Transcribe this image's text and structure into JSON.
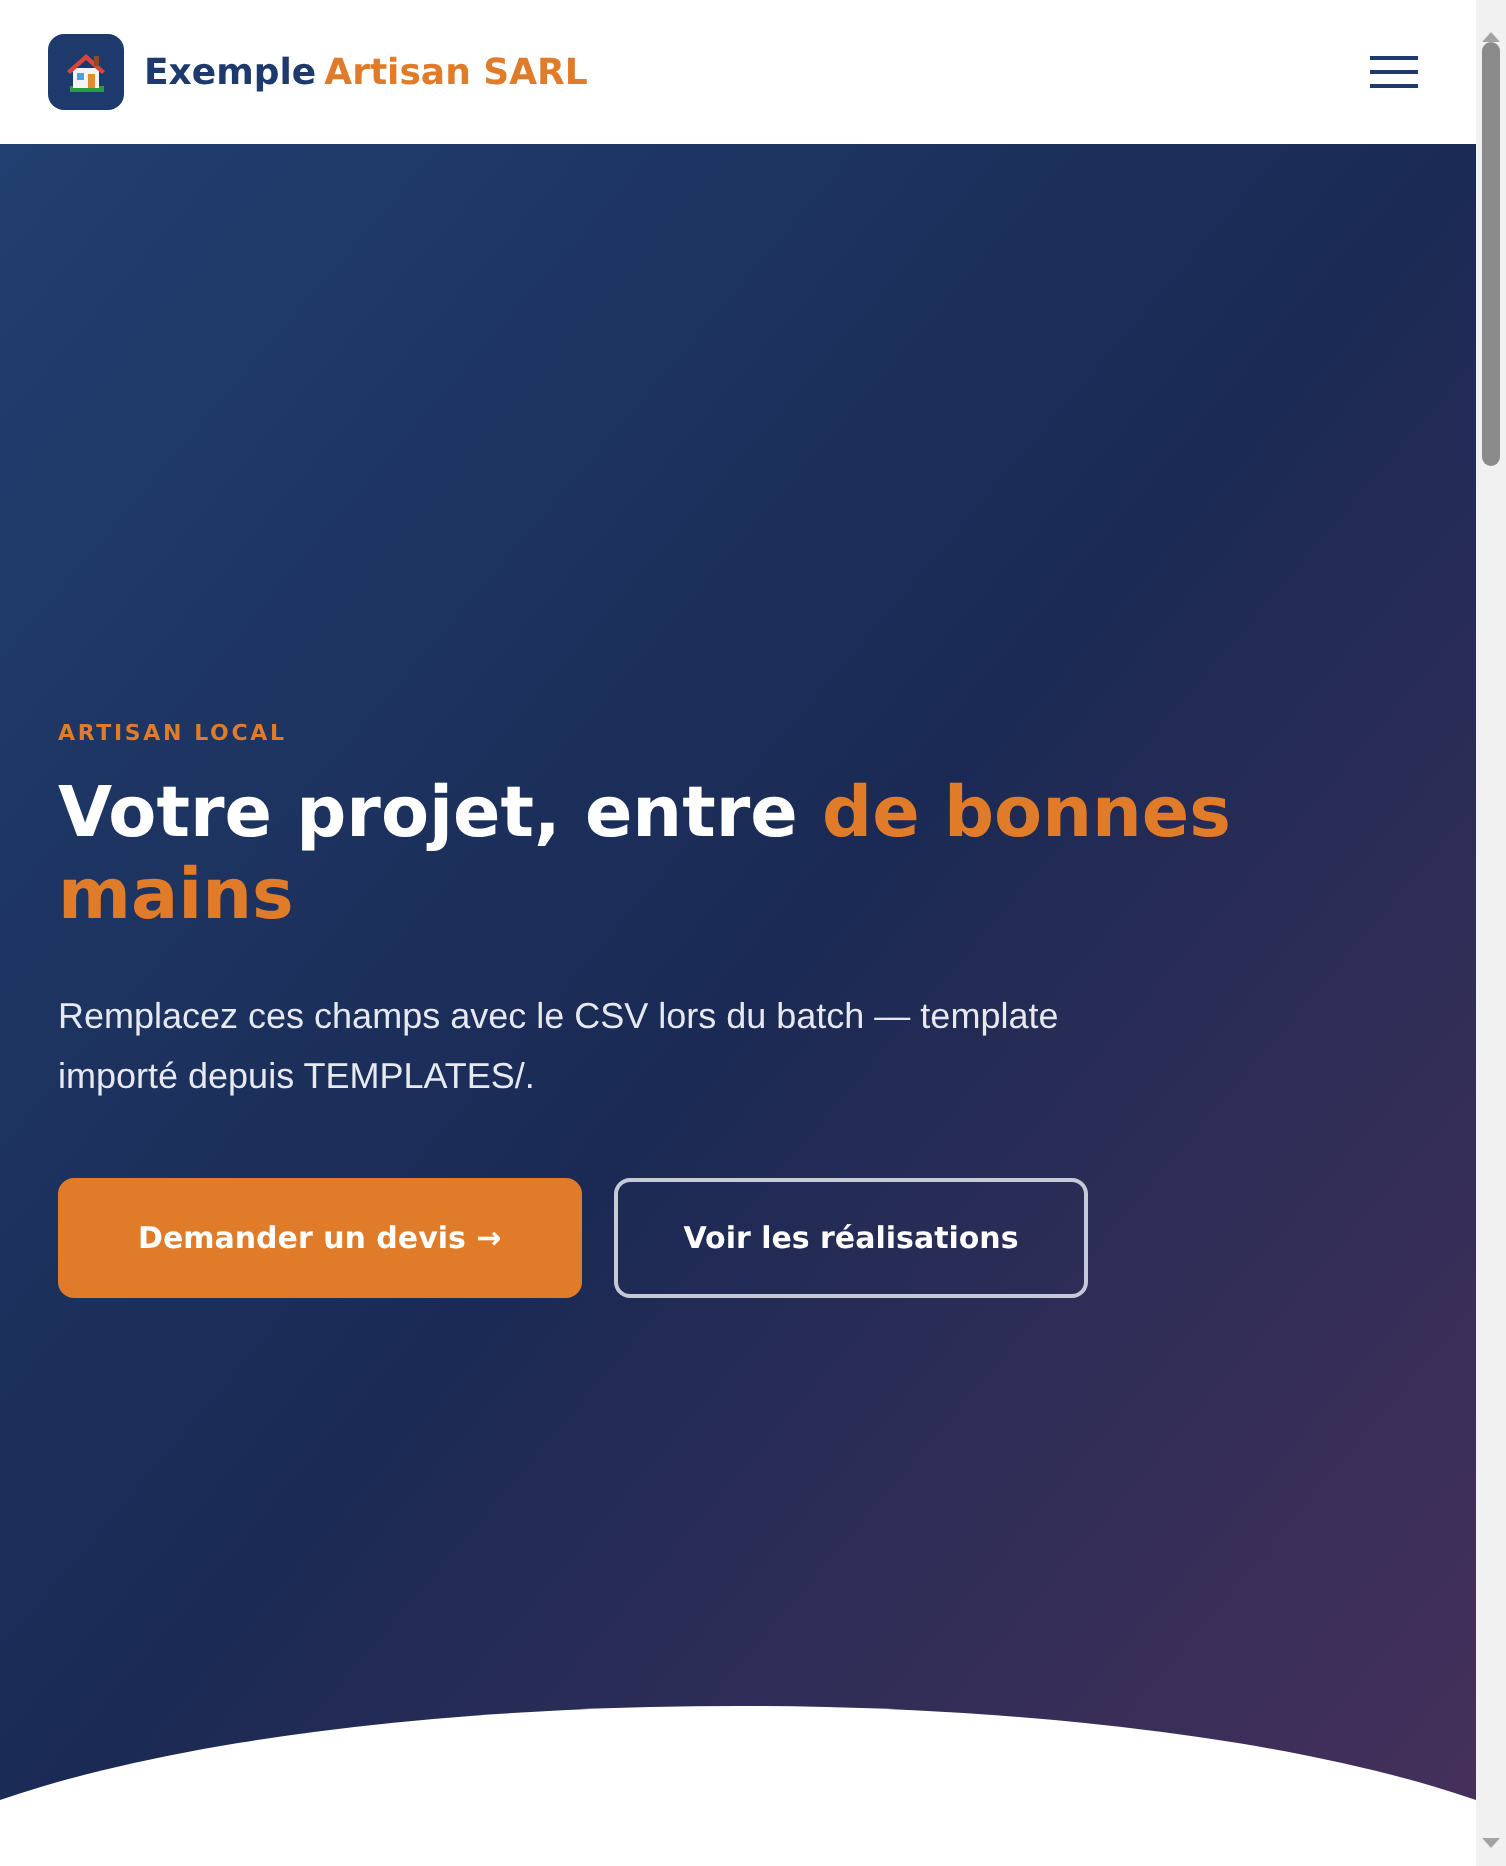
{
  "header": {
    "brand": {
      "name": "Exemple",
      "accent": "Artisan SARL"
    }
  },
  "hero": {
    "eyebrow": "ARTISAN LOCAL",
    "heading": {
      "text": "Votre projet, entre",
      "highlight": "de bonnes mains"
    },
    "description": "Remplacez ces champs avec le CSV lors du batch — template importé depuis TEMPLATES/.",
    "buttons": [
      {
        "label": "Demander un devis →",
        "kind": "primary"
      },
      {
        "label": "Voir les réalisations",
        "kind": "outline"
      }
    ]
  }
}
